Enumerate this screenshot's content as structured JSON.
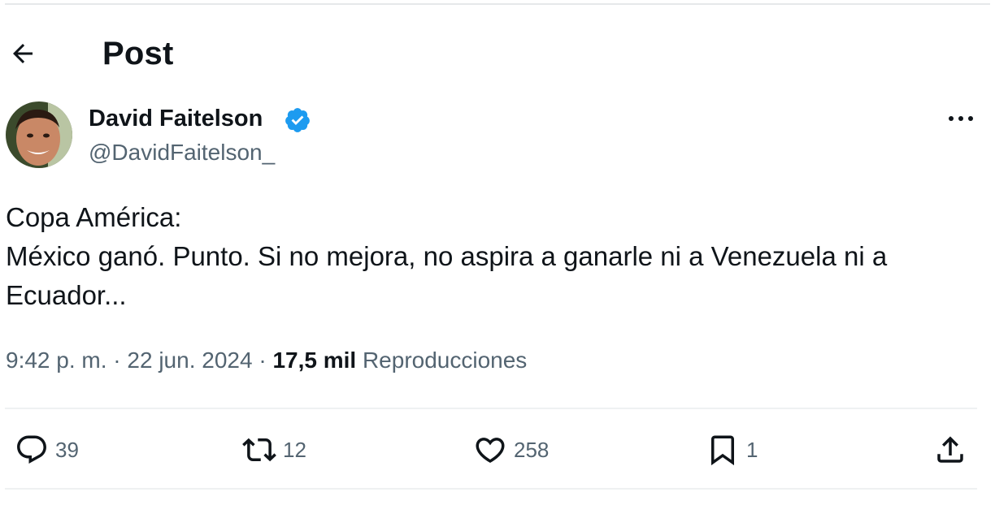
{
  "header": {
    "title": "Post"
  },
  "author": {
    "display_name": "David Faitelson",
    "handle": "@DavidFaitelson_",
    "verified": true
  },
  "tweet": {
    "lines": [
      "Copa América:",
      "México ganó. Punto. Si no mejora, no aspira a ganarle ni a Venezuela ni a",
      "Ecuador..."
    ],
    "time": "9:42 p. m.",
    "separator": "·",
    "date": "22 jun. 2024",
    "views_count": "17,5 mil",
    "views_label": "Reproducciones"
  },
  "actions": {
    "replies": "39",
    "reposts": "12",
    "likes": "258",
    "bookmarks": "1"
  },
  "icons": {
    "back": "arrow-left-icon",
    "verified": "verified-badge-icon",
    "more": "more-horizontal-icon",
    "reply": "reply-icon",
    "repost": "repost-icon",
    "like": "heart-icon",
    "bookmark": "bookmark-icon",
    "share": "share-icon"
  },
  "colors": {
    "verified_blue": "#1d9bf0",
    "text_primary": "#0f1419",
    "text_secondary": "#536471"
  }
}
